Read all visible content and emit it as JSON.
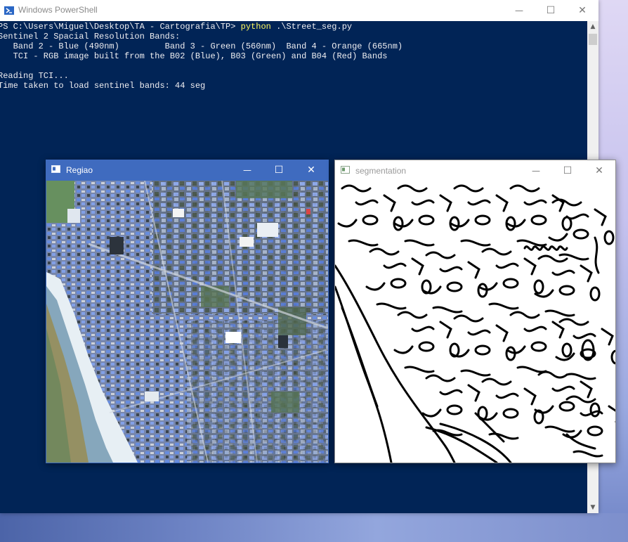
{
  "powershell": {
    "title": "Windows PowerShell",
    "prompt": "PS C:\\Users\\Miguel\\Desktop\\TA - Cartografia\\TP> ",
    "command": "python",
    "command_args": " .\\Street_seg.py",
    "lines": [
      "Sentinel 2 Spacial Resolution Bands:",
      "   Band 2 - Blue (490nm)         Band 3 - Green (560nm)  Band 4 - Orange (665nm)",
      "   TCI - RGB image built from the B02 (Blue), B03 (Green) and B04 (Red) Bands",
      "",
      "Reading TCI...",
      "Time taken to load sentinel bands: 44 seg"
    ],
    "minimize_glyph": "—",
    "maximize_glyph": "☐",
    "close_glyph": "✕",
    "scroll_up_glyph": "▲",
    "scroll_down_glyph": "▼",
    "colors": {
      "background": "#012456",
      "text": "#eeedf0",
      "command": "#fdf65e"
    }
  },
  "regiao_window": {
    "title": "Regiao",
    "minimize_glyph": "—",
    "maximize_glyph": "☐",
    "close_glyph": "✕",
    "icon": "image-window-icon",
    "titlebar_color": "#3f6bbf"
  },
  "segmentation_window": {
    "title": "segmentation",
    "minimize_glyph": "—",
    "maximize_glyph": "☐",
    "close_glyph": "✕",
    "icon": "image-window-icon"
  }
}
